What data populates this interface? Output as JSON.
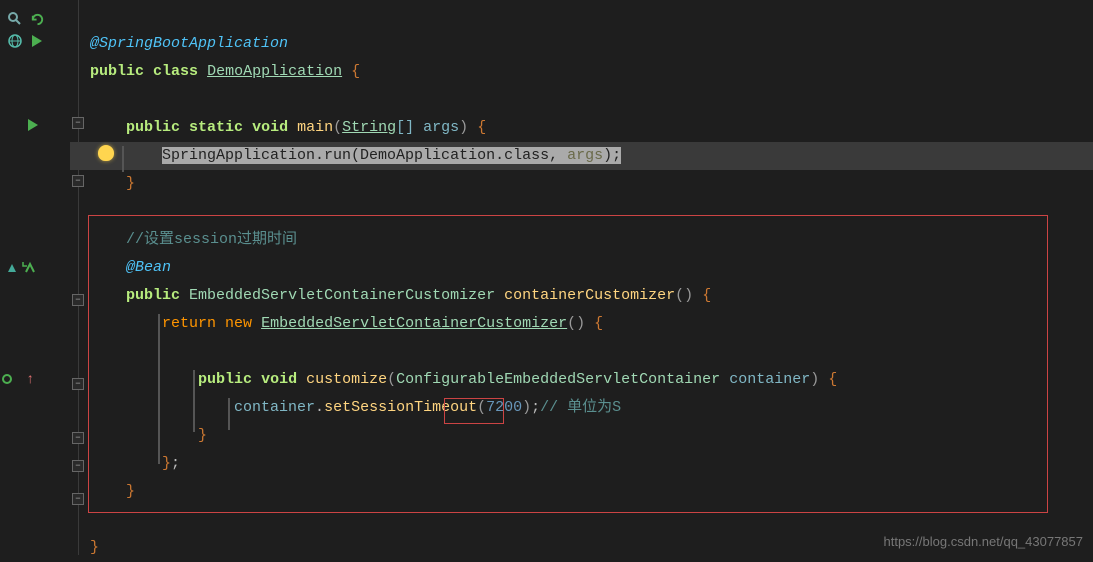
{
  "code": {
    "l1": "@SpringBootApplication",
    "l2_public": "public",
    "l2_class": "class",
    "l2_name": "DemoApplication",
    "l2_brace": "{",
    "l4_public": "public",
    "l4_static": "static",
    "l4_void": "void",
    "l4_main": "main",
    "l4_string": "String",
    "l4_args": "[] args",
    "l4_brace": "{",
    "l5_sel": "SpringApplication.run(DemoApplication.class, ",
    "l5_args": "args",
    "l5_end": ");",
    "l6_brace": "}",
    "l8_comment": "//设置session过期时间",
    "l9": "@Bean",
    "l10_public": "public",
    "l10_type": "EmbeddedServletContainerCustomizer",
    "l10_method": "containerCustomizer",
    "l10_paren": "()",
    "l10_brace": "{",
    "l11_return": "return",
    "l11_new": "new",
    "l11_type": "EmbeddedServletContainerCustomizer",
    "l11_paren": "()",
    "l11_brace": "{",
    "l13_public": "public",
    "l13_void": "void",
    "l13_method": "customize",
    "l13_param_type": "ConfigurableEmbeddedServletContainer",
    "l13_param": "container",
    "l13_brace": "{",
    "l14_container": "container",
    "l14_dot": ".",
    "l14_method": "setSessionTimeout",
    "l14_num": "7200",
    "l14_end": ";",
    "l14_comment": "// 单位为S",
    "l15_brace": "}",
    "l16_brace": "}",
    "l16_semi": ";",
    "l17_brace": "}",
    "l19_brace": "}"
  },
  "watermark": "https://blog.csdn.net/qq_43077857"
}
